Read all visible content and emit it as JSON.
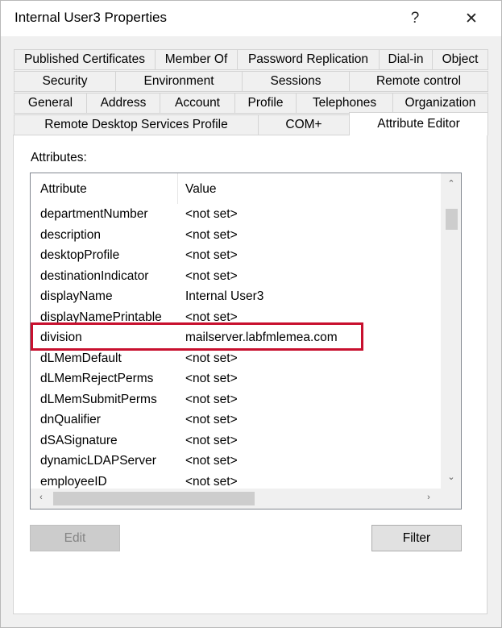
{
  "window": {
    "title": "Internal User3 Properties",
    "help_glyph": "?",
    "close_glyph": "✕"
  },
  "tabs": {
    "row1": [
      "Published Certificates",
      "Member Of",
      "Password Replication",
      "Dial-in",
      "Object"
    ],
    "row2": [
      "Security",
      "Environment",
      "Sessions",
      "Remote control"
    ],
    "row3": [
      "General",
      "Address",
      "Account",
      "Profile",
      "Telephones",
      "Organization"
    ],
    "row4": [
      "Remote Desktop Services Profile",
      "COM+",
      "Attribute Editor"
    ],
    "active": "Attribute Editor"
  },
  "attributes": {
    "caption": "Attributes:",
    "columns": {
      "attribute": "Attribute",
      "value": "Value"
    },
    "rows": [
      {
        "attribute": "departmentNumber",
        "value": "<not set>"
      },
      {
        "attribute": "description",
        "value": "<not set>"
      },
      {
        "attribute": "desktopProfile",
        "value": "<not set>"
      },
      {
        "attribute": "destinationIndicator",
        "value": "<not set>"
      },
      {
        "attribute": "displayName",
        "value": "Internal User3"
      },
      {
        "attribute": "displayNamePrintable",
        "value": "<not set>"
      },
      {
        "attribute": "division",
        "value": "mailserver.labfmlemea.com"
      },
      {
        "attribute": "dLMemDefault",
        "value": "<not set>"
      },
      {
        "attribute": "dLMemRejectPerms",
        "value": "<not set>"
      },
      {
        "attribute": "dLMemSubmitPerms",
        "value": "<not set>"
      },
      {
        "attribute": "dnQualifier",
        "value": "<not set>"
      },
      {
        "attribute": "dSASignature",
        "value": "<not set>"
      },
      {
        "attribute": "dynamicLDAPServer",
        "value": "<not set>"
      },
      {
        "attribute": "employeeID",
        "value": "<not set>"
      }
    ],
    "highlighted_row": "division",
    "highlight_color": "#c8102e"
  },
  "buttons": {
    "edit": "Edit",
    "filter": "Filter"
  }
}
